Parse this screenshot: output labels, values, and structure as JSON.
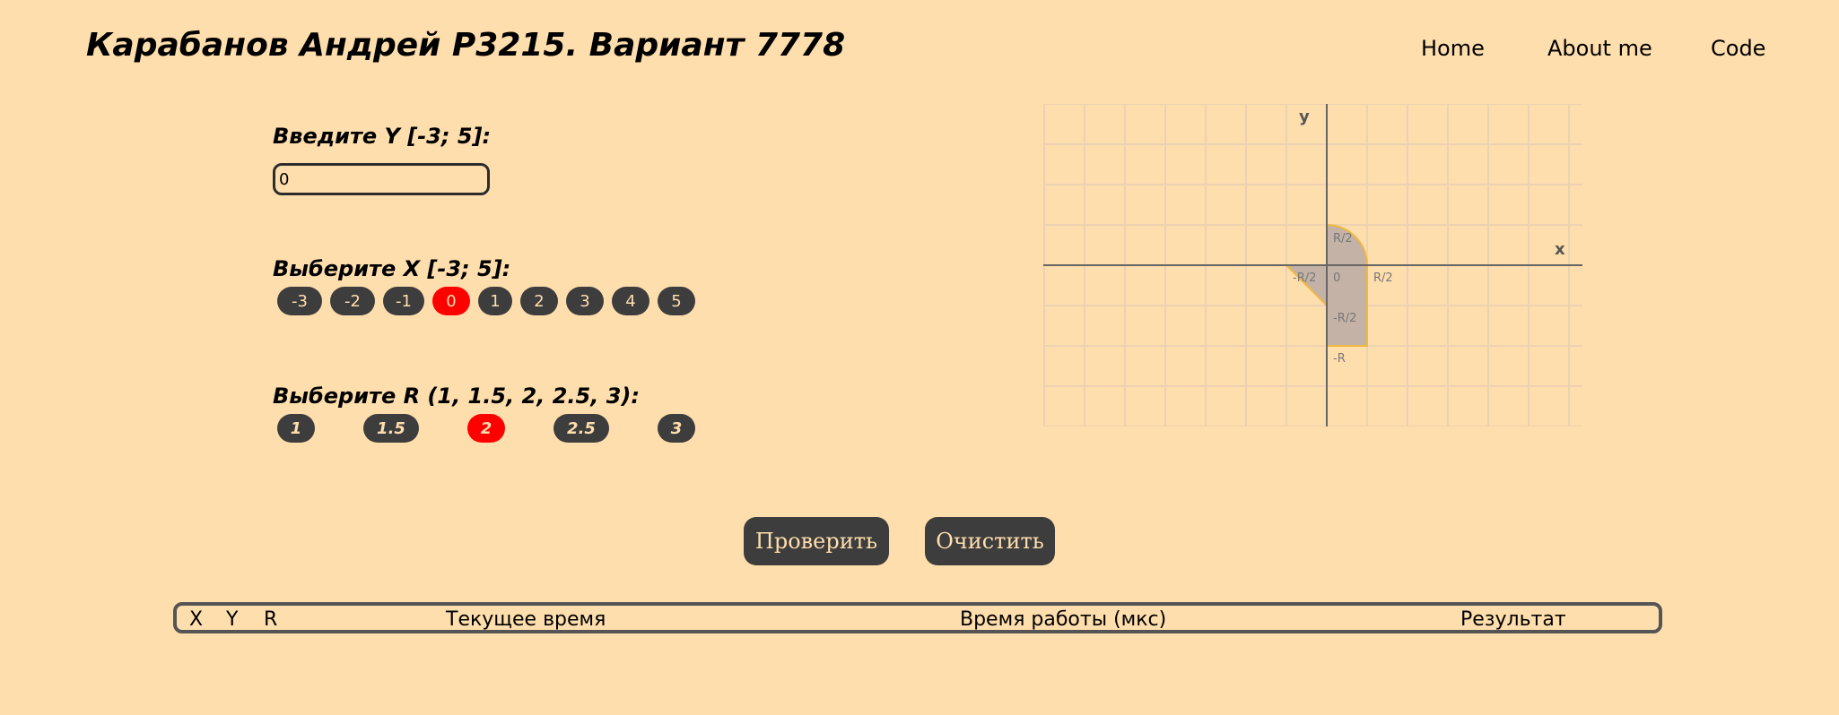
{
  "header": {
    "title": "Карабанов Андрей P3215. Вариант 7778",
    "nav": [
      "Home",
      "About me",
      "Code"
    ]
  },
  "form": {
    "y_label": "Введите Y [-3; 5]:",
    "y_value": "0",
    "x_label": "Выберите X [-3; 5]:",
    "x_options": [
      "-3",
      "-2",
      "-1",
      "0",
      "1",
      "2",
      "3",
      "4",
      "5"
    ],
    "x_selected": "0",
    "r_label": "Выберите R (1, 1.5, 2, 2.5, 3):",
    "r_options": [
      "1",
      "1.5",
      "2",
      "2.5",
      "3"
    ],
    "r_selected": "2"
  },
  "actions": {
    "check_label": "Проверить",
    "clear_label": "Очистить"
  },
  "graph": {
    "x_axis": "x",
    "y_axis": "y",
    "labels": {
      "r_half_top": "R/2",
      "neg_r_half_left": "-R/2",
      "origin": "0",
      "r_half_right": "R/2",
      "neg_r_half_bottom": "-R/2",
      "neg_r": "-R"
    },
    "colors": {
      "area_fill": "#c4b2a6",
      "area_stroke": "#f0b840",
      "grid": "#ecd2b2",
      "axis": "#666666"
    }
  },
  "table": {
    "headers": [
      "X",
      "Y",
      "R",
      "Текущее время",
      "Время работы (мкс)",
      "Результат"
    ]
  },
  "colors": {
    "background": "#ffdead",
    "button": "#3d3d3d",
    "button_text": "#ffdead",
    "selected": "#ff0000"
  }
}
